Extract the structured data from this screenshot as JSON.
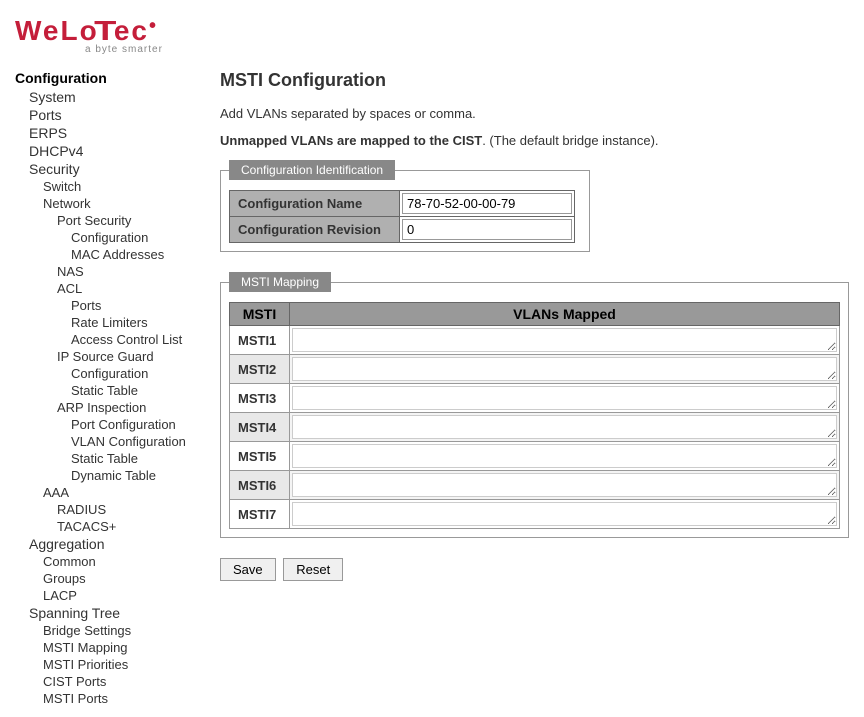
{
  "brand": {
    "name": "WeLoTec",
    "tagline": "a byte smarter"
  },
  "nav": {
    "title": "Configuration",
    "items": [
      {
        "label": "System",
        "indent": 1
      },
      {
        "label": "Ports",
        "indent": 1
      },
      {
        "label": "ERPS",
        "indent": 1
      },
      {
        "label": "DHCPv4",
        "indent": 1
      },
      {
        "label": "Security",
        "indent": 1
      },
      {
        "label": "Switch",
        "indent": 2
      },
      {
        "label": "Network",
        "indent": 2
      },
      {
        "label": "Port Security",
        "indent": 3
      },
      {
        "label": "Configuration",
        "indent": 4
      },
      {
        "label": "MAC Addresses",
        "indent": 4
      },
      {
        "label": "NAS",
        "indent": 3
      },
      {
        "label": "ACL",
        "indent": 3
      },
      {
        "label": "Ports",
        "indent": 4
      },
      {
        "label": "Rate Limiters",
        "indent": 4
      },
      {
        "label": "Access Control List",
        "indent": 4
      },
      {
        "label": "IP Source Guard",
        "indent": 3
      },
      {
        "label": "Configuration",
        "indent": 4
      },
      {
        "label": "Static Table",
        "indent": 4
      },
      {
        "label": "ARP Inspection",
        "indent": 3
      },
      {
        "label": "Port Configuration",
        "indent": 4
      },
      {
        "label": "VLAN Configuration",
        "indent": 4
      },
      {
        "label": "Static Table",
        "indent": 4
      },
      {
        "label": "Dynamic Table",
        "indent": 4
      },
      {
        "label": "AAA",
        "indent": 2
      },
      {
        "label": "RADIUS",
        "indent": 3
      },
      {
        "label": "TACACS+",
        "indent": 3
      },
      {
        "label": "Aggregation",
        "indent": 1
      },
      {
        "label": "Common",
        "indent": 2
      },
      {
        "label": "Groups",
        "indent": 2
      },
      {
        "label": "LACP",
        "indent": 2
      },
      {
        "label": "Spanning Tree",
        "indent": 1
      },
      {
        "label": "Bridge Settings",
        "indent": 2
      },
      {
        "label": "MSTI Mapping",
        "indent": 2
      },
      {
        "label": "MSTI Priorities",
        "indent": 2
      },
      {
        "label": "CIST Ports",
        "indent": 2
      },
      {
        "label": "MSTI Ports",
        "indent": 2
      }
    ]
  },
  "page": {
    "title": "MSTI Configuration",
    "desc1": "Add VLANs separated by spaces or comma.",
    "desc2_bold": "Unmapped VLANs are mapped to the CIST",
    "desc2_rest": ". (The default bridge instance)."
  },
  "config_id": {
    "legend": "Configuration Identification",
    "name_label": "Configuration Name",
    "name_value": "78-70-52-00-00-79",
    "rev_label": "Configuration Revision",
    "rev_value": "0"
  },
  "msti_mapping": {
    "legend": "MSTI Mapping",
    "col_msti": "MSTI",
    "col_vlans": "VLANs Mapped",
    "rows": [
      {
        "label": "MSTI1",
        "value": ""
      },
      {
        "label": "MSTI2",
        "value": ""
      },
      {
        "label": "MSTI3",
        "value": ""
      },
      {
        "label": "MSTI4",
        "value": ""
      },
      {
        "label": "MSTI5",
        "value": ""
      },
      {
        "label": "MSTI6",
        "value": ""
      },
      {
        "label": "MSTI7",
        "value": ""
      }
    ]
  },
  "buttons": {
    "save": "Save",
    "reset": "Reset"
  }
}
